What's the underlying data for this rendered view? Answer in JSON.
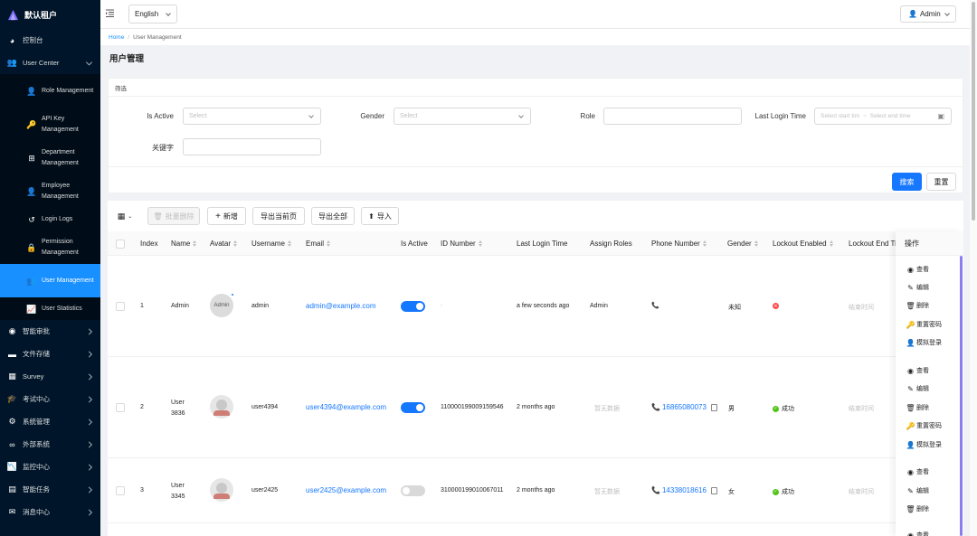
{
  "app": {
    "title": "默认租户"
  },
  "sidebar": {
    "items": [
      {
        "label": "控制台"
      },
      {
        "label": "User Center"
      },
      {
        "label": "智能审批"
      },
      {
        "label": "文件存储"
      },
      {
        "label": "Survey"
      },
      {
        "label": "考试中心"
      },
      {
        "label": "系统管理"
      },
      {
        "label": "外部系统"
      },
      {
        "label": "监控中心"
      },
      {
        "label": "智能任务"
      },
      {
        "label": "消息中心"
      }
    ],
    "user_center_children": [
      {
        "label": "Role Management"
      },
      {
        "label": "API Key Management"
      },
      {
        "label": "Department Management"
      },
      {
        "label": "Employee Management"
      },
      {
        "label": "Login Logs"
      },
      {
        "label": "Permission Management"
      },
      {
        "label": "User Management"
      },
      {
        "label": "User Statistics"
      }
    ]
  },
  "header": {
    "language": "English",
    "user": "Admin"
  },
  "breadcrumb": {
    "home": "Home",
    "separator": "/",
    "current": "User Management"
  },
  "page": {
    "title": "用户管理"
  },
  "filter": {
    "title": "筛选",
    "is_active_label": "Is Active",
    "is_active_placeholder": "Select",
    "gender_label": "Gender",
    "gender_placeholder": "Select",
    "role_label": "Role",
    "last_login_label": "Last Login Time",
    "start_placeholder": "Select start tim",
    "range_separator": "~",
    "end_placeholder": "Select end time",
    "keyword_label": "关键字",
    "search_button": "搜索",
    "reset_button": "重置"
  },
  "toolbar": {
    "batch_delete": "批量删除",
    "add": "新增",
    "export_page": "导出当前页",
    "export_all": "导出全部",
    "import": "导入"
  },
  "table": {
    "columns": {
      "index": "Index",
      "name": "Name",
      "avatar": "Avatar",
      "username": "Username",
      "email": "Email",
      "is_active": "Is Active",
      "id_number": "ID Number",
      "last_login": "Last Login Time",
      "assign_roles": "Assign Roles",
      "phone": "Phone Number",
      "gender": "Gender",
      "lockout_enabled": "Lockout Enabled",
      "lockout_end": "Lockout End Ti",
      "actions": "操作"
    },
    "rows": [
      {
        "index": "1",
        "name": "Admin",
        "avatar_text": "Admin",
        "username": "admin",
        "email": "admin@example.com",
        "is_active": true,
        "id_number": "-",
        "last_login": "a few seconds ago",
        "roles": "Admin",
        "phone": "",
        "gender": "未知",
        "lockout": "",
        "lockout_status": "error",
        "lockout_end": "结束时间"
      },
      {
        "index": "2",
        "name": "User 3836",
        "avatar_text": "",
        "username": "user4394",
        "email": "user4394@example.com",
        "is_active": true,
        "id_number": "110000199009159546",
        "last_login": "2 months ago",
        "roles": "暂无数据",
        "phone": "16865080073",
        "gender": "男",
        "lockout": "成功",
        "lockout_status": "success",
        "lockout_end": "结束时间"
      },
      {
        "index": "3",
        "name": "User 3345",
        "avatar_text": "",
        "username": "user2425",
        "email": "user2425@example.com",
        "is_active": false,
        "id_number": "310000199010067011",
        "last_login": "2 months ago",
        "roles": "暂无数据",
        "phone": "14338018616",
        "gender": "女",
        "lockout": "成功",
        "lockout_status": "success",
        "lockout_end": "结束时间"
      }
    ],
    "actions": {
      "view": "查看",
      "edit": "编辑",
      "delete": "删除",
      "reset_password": "重置密码",
      "impersonate": "模拟登录"
    }
  }
}
